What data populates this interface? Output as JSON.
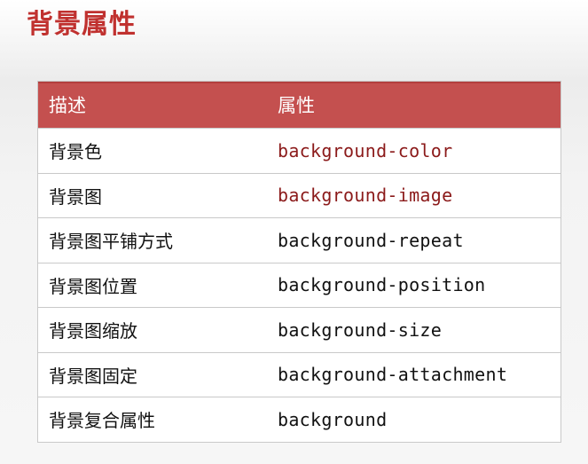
{
  "title": "背景属性",
  "table": {
    "headers": [
      "描述",
      "属性"
    ],
    "rows": [
      {
        "desc": "背景色",
        "prop": "background-color"
      },
      {
        "desc": "背景图",
        "prop": "background-image"
      },
      {
        "desc": "背景图平铺方式",
        "prop": "background-repeat"
      },
      {
        "desc": "背景图位置",
        "prop": "background-position"
      },
      {
        "desc": "背景图缩放",
        "prop": "background-size"
      },
      {
        "desc": "背景图固定",
        "prop": "background-attachment"
      },
      {
        "desc": "背景复合属性",
        "prop": "background"
      }
    ]
  },
  "colors": {
    "title": "#c0312f",
    "header_bg": "#c4504f",
    "accent_text": "#8b1a1a"
  }
}
